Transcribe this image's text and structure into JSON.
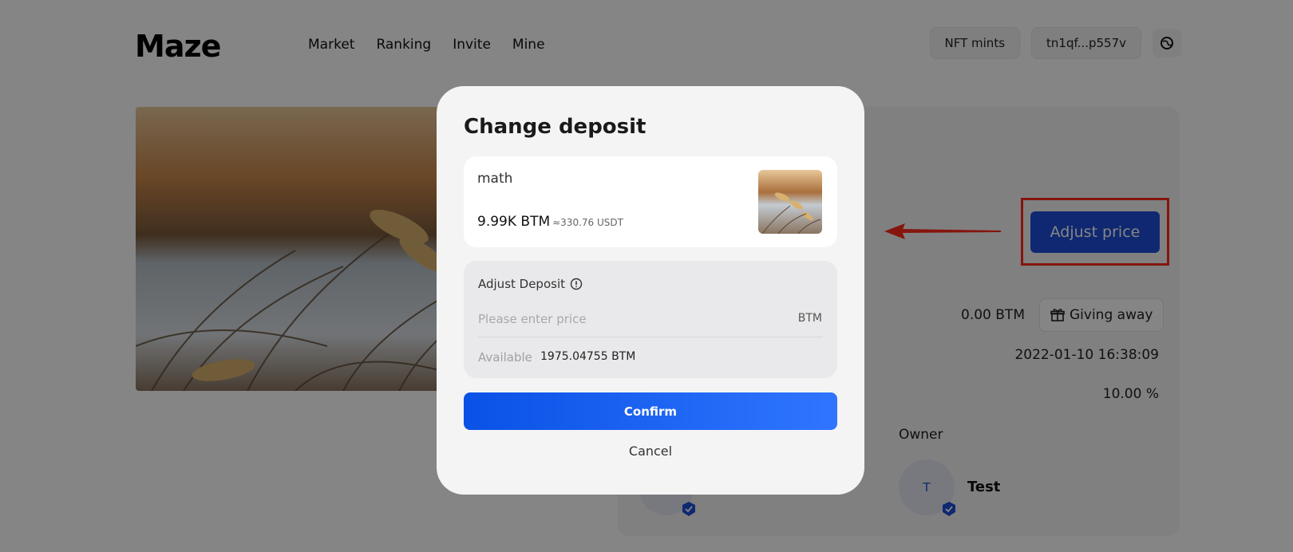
{
  "header": {
    "logo": "Maze",
    "nav": [
      "Market",
      "Ranking",
      "Invite",
      "Mine"
    ],
    "nft_mints_label": "NFT mints",
    "wallet_address": "tn1qf...p557v"
  },
  "detail": {
    "adjust_price_label": "Adjust price",
    "price_value": "0.00 BTM",
    "giving_away_label": "Giving away",
    "date_value": "2022-01-10 16:38:09",
    "percent_value": "10.00 %",
    "owner_label": "Owner",
    "avatar_initial": "T",
    "owner_name": "Test"
  },
  "modal": {
    "title": "Change deposit",
    "nft_name": "math",
    "nft_price": "9.99K BTM",
    "nft_usdt": "≈330.76 USDT",
    "adjust_deposit_label": "Adjust Deposit",
    "price_placeholder": "Please enter price",
    "unit": "BTM",
    "available_label": "Available",
    "available_value": "1975.04755 BTM",
    "confirm_label": "Confirm",
    "cancel_label": "Cancel"
  },
  "colors": {
    "brand_blue": "#1d4ed8",
    "highlight_red": "#ff2a1a",
    "overlay": "rgba(0,0,0,0.48)"
  }
}
